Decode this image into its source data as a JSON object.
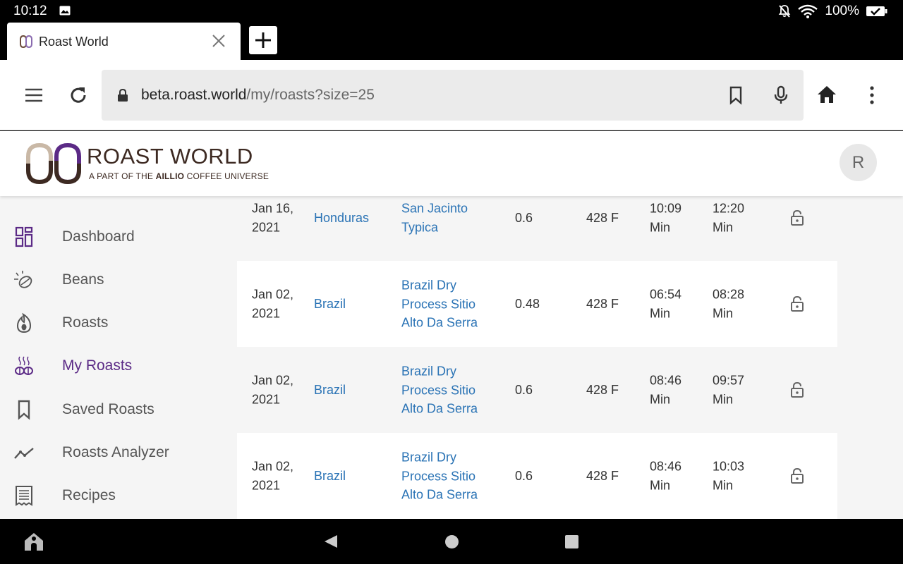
{
  "status_bar": {
    "time": "10:12",
    "battery": "100%"
  },
  "browser": {
    "tab_title": "Roast World",
    "url_host": "beta.roast.world",
    "url_path": "/my/roasts?size=25"
  },
  "site": {
    "name": "ROAST WORLD",
    "tagline_pre": "A PART OF THE ",
    "tagline_brand": "AILLIO",
    "tagline_post": " COFFEE UNIVERSE",
    "avatar_initial": "R"
  },
  "sidebar": {
    "items": [
      {
        "label": "Dashboard",
        "icon": "dashboard-icon",
        "active": false
      },
      {
        "label": "Beans",
        "icon": "bean-icon",
        "active": false
      },
      {
        "label": "Roasts",
        "icon": "flame-icon",
        "active": false
      },
      {
        "label": "My Roasts",
        "icon": "steaming-beans-icon",
        "active": true
      },
      {
        "label": "Saved Roasts",
        "icon": "bookmark-icon",
        "active": false
      },
      {
        "label": "Roasts Analyzer",
        "icon": "trend-line-icon",
        "active": false
      },
      {
        "label": "Recipes",
        "icon": "recipe-icon",
        "active": false
      }
    ]
  },
  "roasts": [
    {
      "date": "Jan 16, 2021",
      "origin": "Honduras",
      "bean": "San Jacinto Typica",
      "batch": "0.6",
      "temp": "428 F",
      "time1": "10:09 Min",
      "time2": "12:20 Min"
    },
    {
      "date": "Jan 02, 2021",
      "origin": "Brazil",
      "bean": "Brazil Dry Process Sitio Alto Da Serra",
      "batch": "0.48",
      "temp": "428 F",
      "time1": "06:54 Min",
      "time2": "08:28 Min"
    },
    {
      "date": "Jan 02, 2021",
      "origin": "Brazil",
      "bean": "Brazil Dry Process Sitio Alto Da Serra",
      "batch": "0.6",
      "temp": "428 F",
      "time1": "08:46 Min",
      "time2": "09:57 Min"
    },
    {
      "date": "Jan 02, 2021",
      "origin": "Brazil",
      "bean": "Brazil Dry Process Sitio Alto Da Serra",
      "batch": "0.6",
      "temp": "428 F",
      "time1": "08:46 Min",
      "time2": "10:03 Min"
    }
  ]
}
